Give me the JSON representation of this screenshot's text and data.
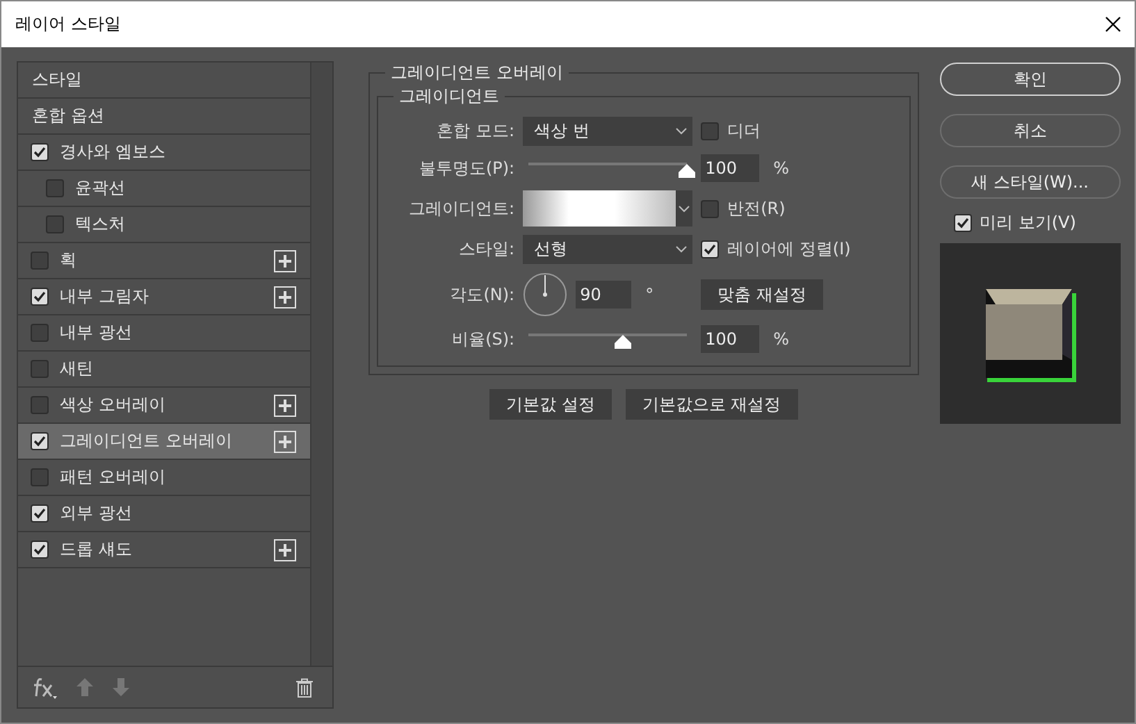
{
  "window": {
    "title": "레이어 스타일"
  },
  "sidebar": {
    "items": [
      {
        "label": "스타일",
        "kind": "header",
        "selected": false
      },
      {
        "label": "혼합 옵션",
        "kind": "header",
        "selected": false
      },
      {
        "label": "경사와 엠보스",
        "kind": "check",
        "checked": true,
        "selected": false,
        "children": [
          {
            "label": "윤곽선",
            "kind": "check",
            "checked": false,
            "selected": false
          },
          {
            "label": "텍스처",
            "kind": "check",
            "checked": false,
            "selected": false
          }
        ]
      },
      {
        "label": "획",
        "kind": "check",
        "checked": false,
        "selected": false,
        "addable": true
      },
      {
        "label": "내부 그림자",
        "kind": "check",
        "checked": true,
        "selected": false,
        "addable": true
      },
      {
        "label": "내부 광선",
        "kind": "check",
        "checked": false,
        "selected": false
      },
      {
        "label": "새틴",
        "kind": "check",
        "checked": false,
        "selected": false
      },
      {
        "label": "색상 오버레이",
        "kind": "check",
        "checked": false,
        "selected": false,
        "addable": true
      },
      {
        "label": "그레이디언트 오버레이",
        "kind": "check",
        "checked": true,
        "selected": true,
        "addable": true
      },
      {
        "label": "패턴 오버레이",
        "kind": "check",
        "checked": false,
        "selected": false
      },
      {
        "label": "외부 광선",
        "kind": "check",
        "checked": true,
        "selected": false
      },
      {
        "label": "드롭 섀도",
        "kind": "check",
        "checked": true,
        "selected": false,
        "addable": true
      }
    ]
  },
  "panel": {
    "title": "그레이디언트 오버레이",
    "group_title": "그레이디언트",
    "blend_mode": {
      "label": "혼합 모드:",
      "value": "색상 번"
    },
    "dither": {
      "label": "디더",
      "checked": false
    },
    "opacity": {
      "label": "불투명도(P):",
      "level": 1.0,
      "value": "100",
      "unit": "%"
    },
    "gradient": {
      "label": "그레이디언트:"
    },
    "reverse": {
      "label": "반전(R)",
      "checked": false
    },
    "style": {
      "label": "스타일:",
      "value": "선형"
    },
    "align": {
      "label": "레이어에 정렬(I)",
      "checked": true
    },
    "angle": {
      "label": "각도(N):",
      "value": "90",
      "unit": "°"
    },
    "angle_reset": "맞춤 재설정",
    "scale": {
      "label": "비율(S):",
      "level": 0.6,
      "value": "100",
      "unit": "%"
    },
    "buttons": [
      "기본값 설정",
      "기본값으로 재설정"
    ]
  },
  "actions": [
    {
      "label": "확인",
      "primary": true
    },
    {
      "label": "취소",
      "primary": false
    },
    {
      "label": "새 스타일(W)...",
      "primary": false
    }
  ],
  "preview": {
    "label": "미리 보기(V)",
    "checked": true
  }
}
